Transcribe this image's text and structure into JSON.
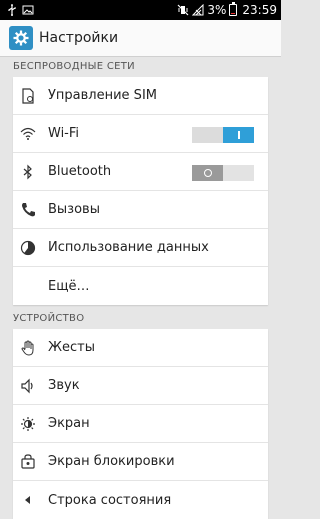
{
  "status_bar": {
    "battery": "3%",
    "time": "23:59"
  },
  "app": {
    "title": "Настройки"
  },
  "sections": {
    "wireless": {
      "header": "БЕСПРОВОДНЫЕ СЕТИ",
      "items": [
        {
          "label": "Управление SIM",
          "icon": "sim-icon"
        },
        {
          "label": "Wi-Fi",
          "icon": "wifi-icon",
          "toggle": "on"
        },
        {
          "label": "Bluetooth",
          "icon": "bluetooth-icon",
          "toggle": "off"
        },
        {
          "label": "Вызовы",
          "icon": "phone-icon"
        },
        {
          "label": "Использование данных",
          "icon": "data-usage-icon"
        },
        {
          "label": "Ещё…",
          "icon": ""
        }
      ]
    },
    "device": {
      "header": "УСТРОЙСТВО",
      "items": [
        {
          "label": "Жесты",
          "icon": "hand-icon"
        },
        {
          "label": "Звук",
          "icon": "speaker-icon"
        },
        {
          "label": "Экран",
          "icon": "brightness-icon"
        },
        {
          "label": "Экран блокировки",
          "icon": "lock-screen-icon"
        },
        {
          "label": "Строка состояния",
          "icon": "status-bar-icon"
        }
      ]
    }
  },
  "colors": {
    "accent": "#2f9fd8",
    "app_icon": "#2f8fc4",
    "background": "#e6e6e6"
  }
}
